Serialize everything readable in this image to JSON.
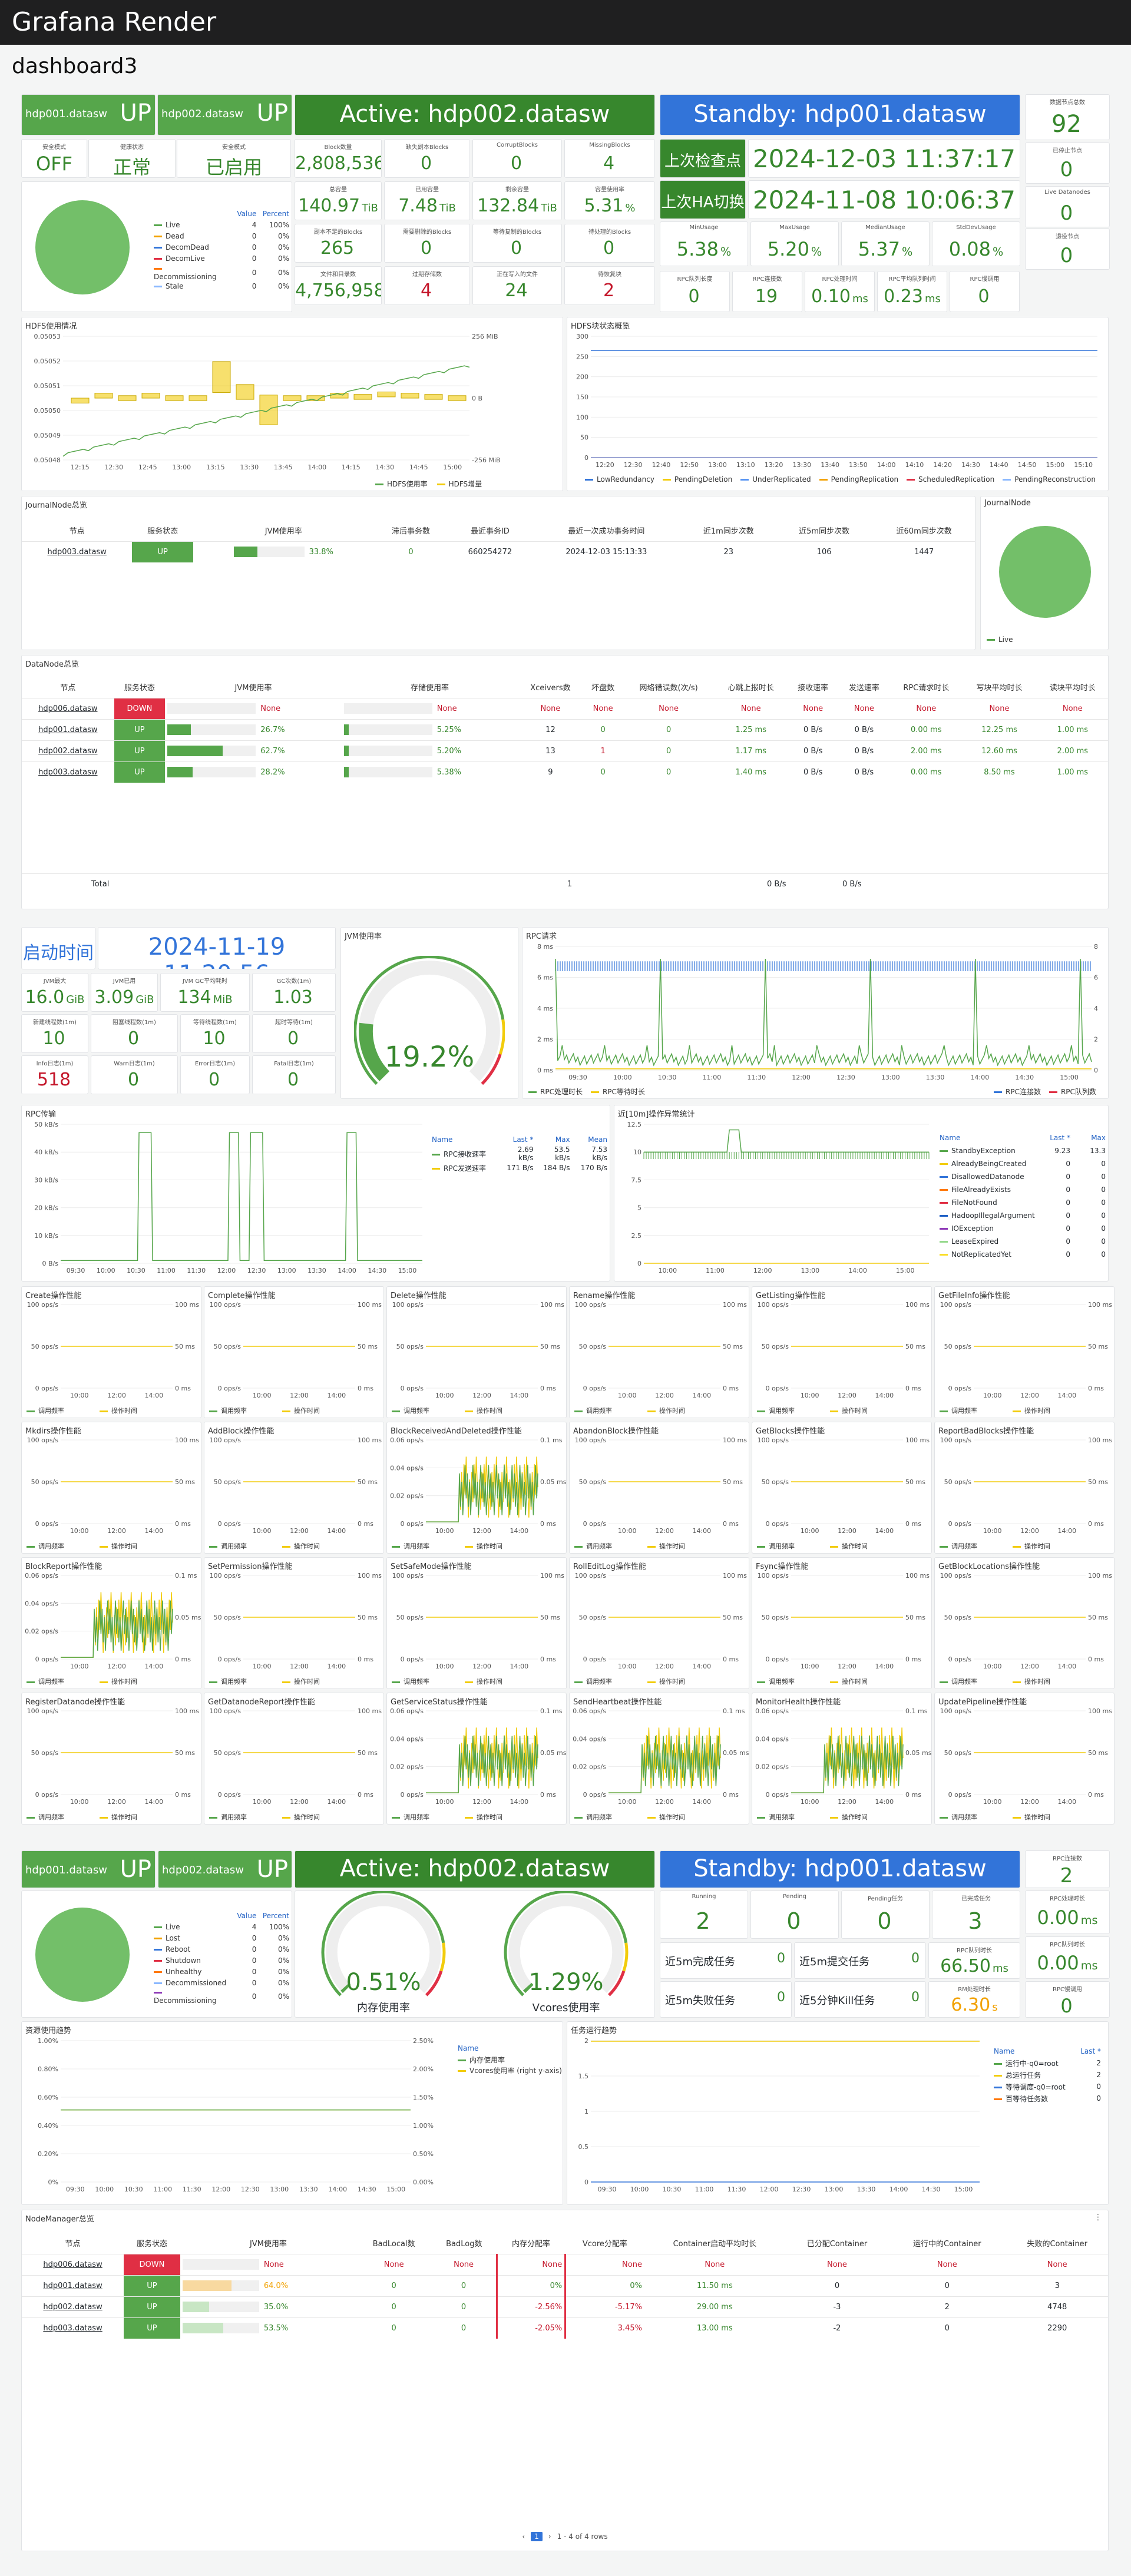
{
  "app": {
    "title": "Grafana Render",
    "dashboard": "dashboard3"
  },
  "hdfs": {
    "nn1": {
      "host": "hdp001.datasw",
      "state": "UP"
    },
    "nn2": {
      "host": "hdp002.datasw",
      "state": "UP"
    },
    "active": "Active: hdp002.datasw",
    "standby": "Standby: hdp001.datasw",
    "safemode": {
      "label": "安全模式",
      "value": "OFF"
    },
    "health": {
      "label": "健康状态",
      "value": "正常"
    },
    "security": {
      "label": "安全模式",
      "value": "已启用"
    },
    "checkpoint_label": "上次检查点",
    "checkpoint_time": "2024-12-03 11:37:17",
    "ha_label": "上次HA切换",
    "ha_time": "2024-11-08 10:06:37",
    "stats": [
      {
        "label": "Block数量",
        "value": "2,808,536"
      },
      {
        "label": "缺失副本Blocks",
        "value": "0"
      },
      {
        "label": "CorruptBlocks",
        "value": "0"
      },
      {
        "label": "MissingBlocks",
        "value": "4"
      },
      {
        "label": "总容量",
        "value": "140.97",
        "unit": "TiB"
      },
      {
        "label": "已用容量",
        "value": "7.48",
        "unit": "TiB"
      },
      {
        "label": "剩余容量",
        "value": "132.84",
        "unit": "TiB"
      },
      {
        "label": "容量使用率",
        "value": "5.31",
        "unit": "%"
      },
      {
        "label": "副本不足的Blocks",
        "value": "265"
      },
      {
        "label": "需要删除的Blocks",
        "value": "0"
      },
      {
        "label": "等待复制的Blocks",
        "value": "0"
      },
      {
        "label": "待处理的Blocks",
        "value": "0"
      },
      {
        "label": "文件和目录数",
        "value": "4,756,958"
      },
      {
        "label": "过期存储数",
        "value": "4"
      },
      {
        "label": "正在写入的文件",
        "value": "24"
      },
      {
        "label": "待恢复块",
        "value": "2"
      }
    ],
    "usage": [
      {
        "label": "MinUsage",
        "value": "5.38",
        "unit": "%"
      },
      {
        "label": "MaxUsage",
        "value": "5.20",
        "unit": "%"
      },
      {
        "label": "MedianUsage",
        "value": "5.37",
        "unit": "%"
      },
      {
        "label": "StdDevUsage",
        "value": "0.08",
        "unit": "%"
      }
    ],
    "rpc": [
      {
        "label": "RPC队列长度",
        "value": "0"
      },
      {
        "label": "RPC连接数",
        "value": "19"
      },
      {
        "label": "RPC处理时间",
        "value": "0.10",
        "unit": "ms"
      },
      {
        "label": "RPC平均队列时间",
        "value": "0.23",
        "unit": "ms"
      },
      {
        "label": "RPC慢调用",
        "value": "0"
      }
    ],
    "right_stats": [
      {
        "label": "数据节点总数",
        "value": "92"
      },
      {
        "label": "已停止节点",
        "value": "0"
      },
      {
        "label": "Live Datanodes",
        "value": "0"
      },
      {
        "label": "退役节点",
        "value": "0"
      }
    ],
    "dn_legend_headers": [
      "Value",
      "Percent"
    ],
    "dn_states": [
      {
        "name": "Live",
        "value": "4",
        "pct": "100%",
        "color": "#56a64b"
      },
      {
        "name": "Dead",
        "value": "0",
        "pct": "0%",
        "color": "#f2a100"
      },
      {
        "name": "DecomDead",
        "value": "0",
        "pct": "0%",
        "color": "#3274d9"
      },
      {
        "name": "DecomLive",
        "value": "0",
        "pct": "0%",
        "color": "#e02f44"
      },
      {
        "name": "Decommissioning",
        "value": "0",
        "pct": "0%",
        "color": "#ff780a"
      },
      {
        "name": "Stale",
        "value": "0",
        "pct": "0%",
        "color": "#8ab8ff"
      }
    ]
  },
  "chart_data": [
    {
      "type": "candlestick",
      "title": "HDFS使用情况",
      "ylabel": "",
      "y_left": [
        "0.05053",
        "0.05052",
        "0.05051",
        "0.05050",
        "0.05049",
        "0.05048"
      ],
      "y_right": [
        "256 MiB",
        "0 B",
        "-256 MiB"
      ],
      "x": [
        "12:15",
        "12:30",
        "12:45",
        "13:00",
        "13:15",
        "13:30",
        "13:45",
        "14:00",
        "14:15",
        "14:30",
        "14:45",
        "15:00"
      ],
      "legend": [
        "HDFS使用率",
        "HDFS增量"
      ]
    },
    {
      "type": "line",
      "title": "HDFS块状态概览",
      "y_ticks": [
        0,
        50,
        100,
        150,
        200,
        250,
        300
      ],
      "x": [
        "12:20",
        "12:30",
        "12:40",
        "12:50",
        "13:00",
        "13:10",
        "13:20",
        "13:30",
        "13:40",
        "13:50",
        "14:00",
        "14:10",
        "14:20",
        "14:30",
        "14:40",
        "14:50",
        "15:00",
        "15:10"
      ],
      "series": [
        {
          "name": "LowRedundancy",
          "value": 265,
          "color": "#3274d9"
        },
        {
          "name": "PendingDeletion",
          "value": 0,
          "color": "#f2cc0c"
        },
        {
          "name": "UnderReplicated",
          "value": 0,
          "color": "#5794f2"
        },
        {
          "name": "PendingReplication",
          "value": 0,
          "color": "#f2a100"
        },
        {
          "name": "ScheduledReplication",
          "value": 0,
          "color": "#e02f44"
        },
        {
          "name": "PendingReconstruction",
          "value": 0,
          "color": "#8ab8ff"
        }
      ]
    }
  ],
  "journal": {
    "title": "JournalNode总览",
    "pie_title": "JournalNode",
    "pie_legend": "Live",
    "headers": [
      "节点",
      "服务状态",
      "JVM使用率",
      "滞后事务数",
      "最近事务ID",
      "最近一次成功事务时间",
      "近1m同步次数",
      "近5m同步次数",
      "近60m同步次数"
    ],
    "rows": [
      {
        "node": "hdp003.datasw",
        "state": "UP",
        "jvm": "33.8%",
        "lag": "0",
        "txid": "660254272",
        "time": "2024-12-03 15:13:33",
        "s1": "23",
        "s5": "106",
        "s60": "1447"
      }
    ]
  },
  "datanode": {
    "title": "DataNode总览",
    "headers": [
      "节点",
      "服务状态",
      "JVM使用率",
      "存储使用率",
      "Xceivers数",
      "坏盘数",
      "网络错误数(次/s)",
      "心跳上报时长",
      "接收速率",
      "发送速率",
      "RPC请求时长",
      "写块平均时长",
      "读块平均时长"
    ],
    "rows": [
      {
        "node": "hdp006.datasw",
        "state": "DOWN",
        "jvm": "None",
        "store": "None",
        "x": "None",
        "bad": "None",
        "net": "None",
        "hb": "None",
        "rx": "None",
        "tx": "None",
        "rpc": "None",
        "w": "None",
        "r": "None",
        "jp": 0,
        "sp": 0
      },
      {
        "node": "hdp001.datasw",
        "state": "UP",
        "jvm": "26.7%",
        "store": "5.25%",
        "x": "12",
        "bad": "0",
        "net": "0",
        "hb": "1.25 ms",
        "rx": "0 B/s",
        "tx": "0 B/s",
        "rpc": "0.00 ms",
        "w": "12.25 ms",
        "r": "1.00 ms",
        "jp": 0.267,
        "sp": 0.0525
      },
      {
        "node": "hdp002.datasw",
        "state": "UP",
        "jvm": "62.7%",
        "store": "5.20%",
        "x": "13",
        "bad": "1",
        "net": "0",
        "hb": "1.17 ms",
        "rx": "0 B/s",
        "tx": "0 B/s",
        "rpc": "2.00 ms",
        "w": "12.60 ms",
        "r": "2.00 ms",
        "jp": 0.627,
        "sp": 0.052
      },
      {
        "node": "hdp003.datasw",
        "state": "UP",
        "jvm": "28.2%",
        "store": "5.38%",
        "x": "9",
        "bad": "0",
        "net": "0",
        "hb": "1.40 ms",
        "rx": "0 B/s",
        "tx": "0 B/s",
        "rpc": "0.00 ms",
        "w": "8.50 ms",
        "r": "1.00 ms",
        "jp": 0.282,
        "sp": 0.0538
      }
    ],
    "total_label": "Total",
    "total_bad": "1",
    "total_rx": "0 B/s",
    "total_tx": "0 B/s"
  },
  "nn": {
    "start_label": "启动时间",
    "start_time": "2024-11-19 11:20:56",
    "jvm_title": "JVM使用率",
    "jvm_value": "19.2%",
    "jvm_frac": 0.192,
    "stats": [
      {
        "label": "JVM最大",
        "value": "16.0",
        "unit": "GiB"
      },
      {
        "label": "JVM已用",
        "value": "3.09",
        "unit": "GiB"
      },
      {
        "label": "JVM GC平均耗时",
        "value": "134",
        "unit": "MiB"
      },
      {
        "label": "GC次数(1m)",
        "value": "1.03"
      },
      {
        "label": "新建线程数(1m)",
        "value": "10"
      },
      {
        "label": "阻塞线程数(1m)",
        "value": "0"
      },
      {
        "label": "等待线程数(1m)",
        "value": "10"
      },
      {
        "label": "超时等待(1m)",
        "value": "0"
      },
      {
        "label": "Info日志(1m)",
        "value": "518",
        "red": true
      },
      {
        "label": "Warn日志(1m)",
        "value": "0"
      },
      {
        "label": "Error日志(1m)",
        "value": "0"
      },
      {
        "label": "Fatal日志(1m)",
        "value": "0"
      }
    ],
    "rpc_req_title": "RPC请求",
    "rpc_req_y": [
      "8 ms",
      "6 ms",
      "4 ms",
      "2 ms",
      "0 ms"
    ],
    "rpc_req_yr": [
      "8",
      "6",
      "4",
      "2",
      "0"
    ],
    "rpc_req_legend": [
      "RPC处理时长",
      "RPC等待时长"
    ],
    "rpc_req_legend_r": [
      "RPC连接数",
      "RPC队列数"
    ],
    "rpc_tx_title": "RPC传输",
    "rpc_tx_y": [
      "50 kB/s",
      "40 kB/s",
      "30 kB/s",
      "20 kB/s",
      "10 kB/s",
      "0 B/s"
    ],
    "rpc_tx_headers": [
      "Name",
      "Last *",
      "Max",
      "Mean"
    ],
    "rpc_tx_rows": [
      {
        "name": "RPC接收速率",
        "last": "2.69 kB/s",
        "max": "53.5 kB/s",
        "mean": "7.53 kB/s",
        "color": "#56a64b"
      },
      {
        "name": "RPC发送速率",
        "last": "171 B/s",
        "max": "184 B/s",
        "mean": "170 B/s",
        "color": "#f2cc0c"
      }
    ],
    "ops_title": "近[10m]操作异常统计",
    "ops_y": [
      "12.5",
      "10",
      "7.5",
      "5",
      "2.5",
      "0"
    ],
    "ops_headers": [
      "Name",
      "Last *",
      "Max"
    ],
    "ops_rows": [
      {
        "name": "StandbyException",
        "last": "9.23",
        "max": "13.3",
        "color": "#56a64b"
      },
      {
        "name": "AlreadyBeingCreated",
        "last": "0",
        "max": "0",
        "color": "#f2cc0c"
      },
      {
        "name": "DisallowedDatanode",
        "last": "0",
        "max": "0",
        "color": "#3274d9"
      },
      {
        "name": "FileAlreadyExists",
        "last": "0",
        "max": "0",
        "color": "#ff780a"
      },
      {
        "name": "FileNotFound",
        "last": "0",
        "max": "0",
        "color": "#e02f44"
      },
      {
        "name": "HadoopIllegalArgument",
        "last": "0",
        "max": "0",
        "color": "#1f60c4"
      },
      {
        "name": "IOException",
        "last": "0",
        "max": "0",
        "color": "#8f3bb8"
      },
      {
        "name": "LeaseExpired",
        "last": "0",
        "max": "0",
        "color": "#96d98d"
      },
      {
        "name": "NotReplicatedYet",
        "last": "0",
        "max": "0",
        "color": "#fade2a"
      }
    ],
    "time_x": [
      "09:30",
      "10:00",
      "10:30",
      "11:00",
      "11:30",
      "12:00",
      "12:30",
      "13:00",
      "13:30",
      "14:00",
      "14:30",
      "15:00"
    ]
  },
  "opnames": [
    "Create操作性能",
    "Complete操作性能",
    "Delete操作性能",
    "Rename操作性能",
    "GetListing操作性能",
    "GetFileInfo操作性能",
    "Mkdirs操作性能",
    "AddBlock操作性能",
    "BlockReceivedAndDeleted操作性能",
    "AbandonBlock操作性能",
    "GetBlocks操作性能",
    "ReportBadBlocks操作性能",
    "BlockReport操作性能",
    "SetPermission操作性能",
    "SetSafeMode操作性能",
    "RollEditLog操作性能",
    "Fsync操作性能",
    "GetBlockLocations操作性能",
    "RegisterDatanode操作性能",
    "GetDatanodeReport操作性能",
    "GetServiceStatus操作性能",
    "SendHeartbeat操作性能",
    "MonitorHealth操作性能",
    "UpdatePipeline操作性能"
  ],
  "op_legend": [
    "调用频率",
    "操作时间"
  ],
  "op_x": [
    "10:00",
    "12:00",
    "14:00"
  ],
  "yarn": {
    "rm1": {
      "host": "hdp001.datasw",
      "state": "UP"
    },
    "rm2": {
      "host": "hdp002.datasw",
      "state": "UP"
    },
    "active": "Active: hdp002.datasw",
    "standby": "Standby: hdp001.datasw",
    "legend_headers": [
      "Value",
      "Percent"
    ],
    "nm_states": [
      {
        "name": "Live",
        "value": "4",
        "pct": "100%",
        "color": "#56a64b"
      },
      {
        "name": "Lost",
        "value": "0",
        "pct": "0%",
        "color": "#f2a100"
      },
      {
        "name": "Reboot",
        "value": "0",
        "pct": "0%",
        "color": "#3274d9"
      },
      {
        "name": "Shutdown",
        "value": "0",
        "pct": "0%",
        "color": "#e02f44"
      },
      {
        "name": "Unhealthy",
        "value": "0",
        "pct": "0%",
        "color": "#ff780a"
      },
      {
        "name": "Decommissioned",
        "value": "0",
        "pct": "0%",
        "color": "#8ab8ff"
      },
      {
        "name": "Decommissioning",
        "value": "0",
        "pct": "0%",
        "color": "#8f3bb8"
      }
    ],
    "mem_value": "0.51%",
    "mem_frac": 0.0051,
    "mem_label": "内存使用率",
    "vc_value": "1.29%",
    "vc_frac": 0.0129,
    "vc_label": "Vcores使用率",
    "apps": [
      {
        "label": "Running",
        "value": "2"
      },
      {
        "label": "Pending",
        "value": "0"
      },
      {
        "label": "Pending任务",
        "value": "0"
      },
      {
        "label": "已完成任务",
        "value": "3"
      }
    ],
    "five": [
      {
        "label": "近5m完成任务",
        "value": "0"
      },
      {
        "label": "近5m提交任务",
        "value": "0"
      },
      {
        "label": "近5m失败任务",
        "value": "0"
      },
      {
        "label": "近5分钟Kill任务",
        "value": "0"
      }
    ],
    "rpc1": {
      "label": "RPC队列时长",
      "value": "66.50",
      "unit": "ms"
    },
    "rpc2": {
      "label": "RM处理时长",
      "value": "6.30",
      "unit": "s"
    },
    "right": [
      {
        "label": "RPC连接数",
        "value": "2"
      },
      {
        "label": "RPC处理时长",
        "value": "0.00",
        "unit": "ms"
      },
      {
        "label": "RPC队列时长",
        "value": "0.00",
        "unit": "ms"
      },
      {
        "label": "RPC慢调用",
        "value": "0"
      }
    ],
    "res_title": "资源使用趋势",
    "res_y": [
      "1.00%",
      "0.80%",
      "0.60%",
      "0.40%",
      "0.20%",
      "0%"
    ],
    "res_yr": [
      "2.50%",
      "2.00%",
      "1.50%",
      "1.00%",
      "0.50%",
      "0.00%"
    ],
    "res_legend_header": "Name",
    "res_legend": [
      {
        "name": "内存使用率",
        "color": "#56a64b"
      },
      {
        "name": "Vcores使用率 (right y-axis)",
        "color": "#f2cc0c"
      }
    ],
    "task_title": "任务运行趋势",
    "task_y": [
      "2",
      "1.5",
      "1",
      "0.5",
      "0"
    ],
    "task_headers": [
      "Name",
      "Last *"
    ],
    "task_rows": [
      {
        "name": "运行中-q0=root",
        "last": "2",
        "color": "#56a64b"
      },
      {
        "name": "总运行任务",
        "last": "2",
        "color": "#f2cc0c"
      },
      {
        "name": "等待调度-q0=root",
        "last": "0",
        "color": "#3274d9"
      },
      {
        "name": "百等待任务数",
        "last": "0",
        "color": "#ff780a"
      }
    ],
    "time_x": [
      "09:30",
      "10:00",
      "10:30",
      "11:00",
      "11:30",
      "12:00",
      "12:30",
      "13:00",
      "13:30",
      "14:00",
      "14:30",
      "15:00"
    ]
  },
  "nm": {
    "title": "NodeManager总览",
    "headers": [
      "节点",
      "服务状态",
      "JVM使用率",
      "BadLocal数",
      "BadLog数",
      "内存分配率",
      "Vcore分配率",
      "Container启动平均时长",
      "已分配Container",
      "运行中的Container",
      "失败的Container"
    ],
    "rows": [
      {
        "node": "hdp006.datasw",
        "state": "DOWN",
        "jvm": "None",
        "bl": "None",
        "bg": "None",
        "mem": "None",
        "vc": "None",
        "cs": "None",
        "ac": "None",
        "rc": "None",
        "fc": "None",
        "jp": 0
      },
      {
        "node": "hdp001.datasw",
        "state": "UP",
        "jvm": "64.0%",
        "bl": "0",
        "bg": "0",
        "mem": "0%",
        "vc": "0%",
        "cs": "11.50 ms",
        "ac": "0",
        "rc": "0",
        "fc": "3",
        "jp": 0.64
      },
      {
        "node": "hdp002.datasw",
        "state": "UP",
        "jvm": "35.0%",
        "bl": "0",
        "bg": "0",
        "mem": "-2.56%",
        "vc": "-5.17%",
        "cs": "29.00 ms",
        "ac": "-3",
        "rc": "2",
        "fc": "4748",
        "jp": 0.35
      },
      {
        "node": "hdp003.datasw",
        "state": "UP",
        "jvm": "53.5%",
        "bl": "0",
        "bg": "0",
        "mem": "-2.05%",
        "vc": "3.45%",
        "cs": "13.00 ms",
        "ac": "-2",
        "rc": "0",
        "fc": "2290",
        "jp": 0.535
      }
    ],
    "pager": "1 - 4 of 4 rows",
    "page": "1"
  }
}
